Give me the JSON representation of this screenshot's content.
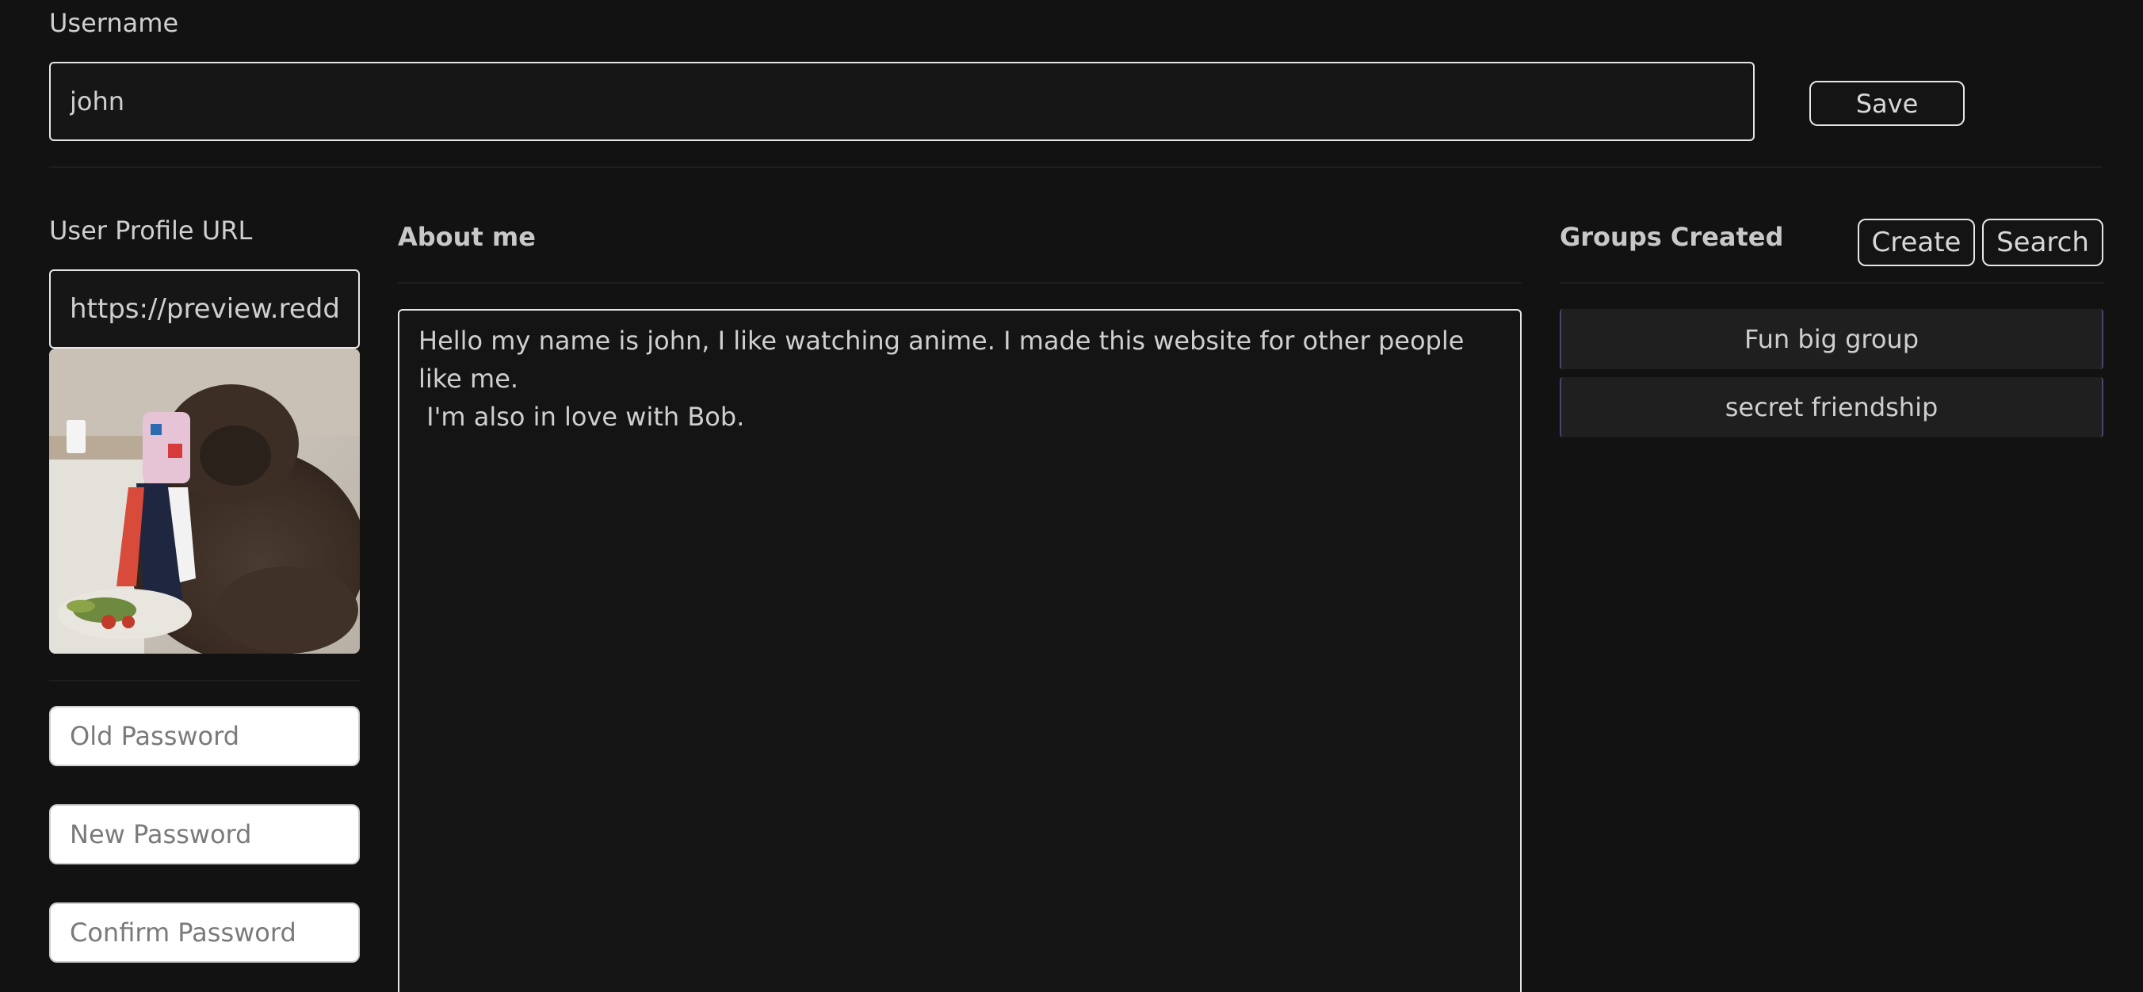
{
  "username": {
    "label": "Username",
    "value": "john",
    "save_label": "Save"
  },
  "profile": {
    "url_label": "User Profile URL",
    "url_value": "https://preview.redd.it/e"
  },
  "passwords": {
    "old_placeholder": "Old Password",
    "new_placeholder": "New Password",
    "confirm_placeholder": "Confirm Password"
  },
  "about": {
    "heading": "About me",
    "text": "Hello my name is john, I like watching anime. I made this website for other people like me.\n I'm also in love with Bob."
  },
  "groups": {
    "heading": "Groups Created",
    "create_label": "Create",
    "search_label": "Search",
    "items": [
      {
        "label": "Fun big group"
      },
      {
        "label": "secret friendship"
      }
    ]
  },
  "colors": {
    "background": "#121212",
    "border": "#e6e6e6",
    "group_accent": "#4a4470"
  }
}
